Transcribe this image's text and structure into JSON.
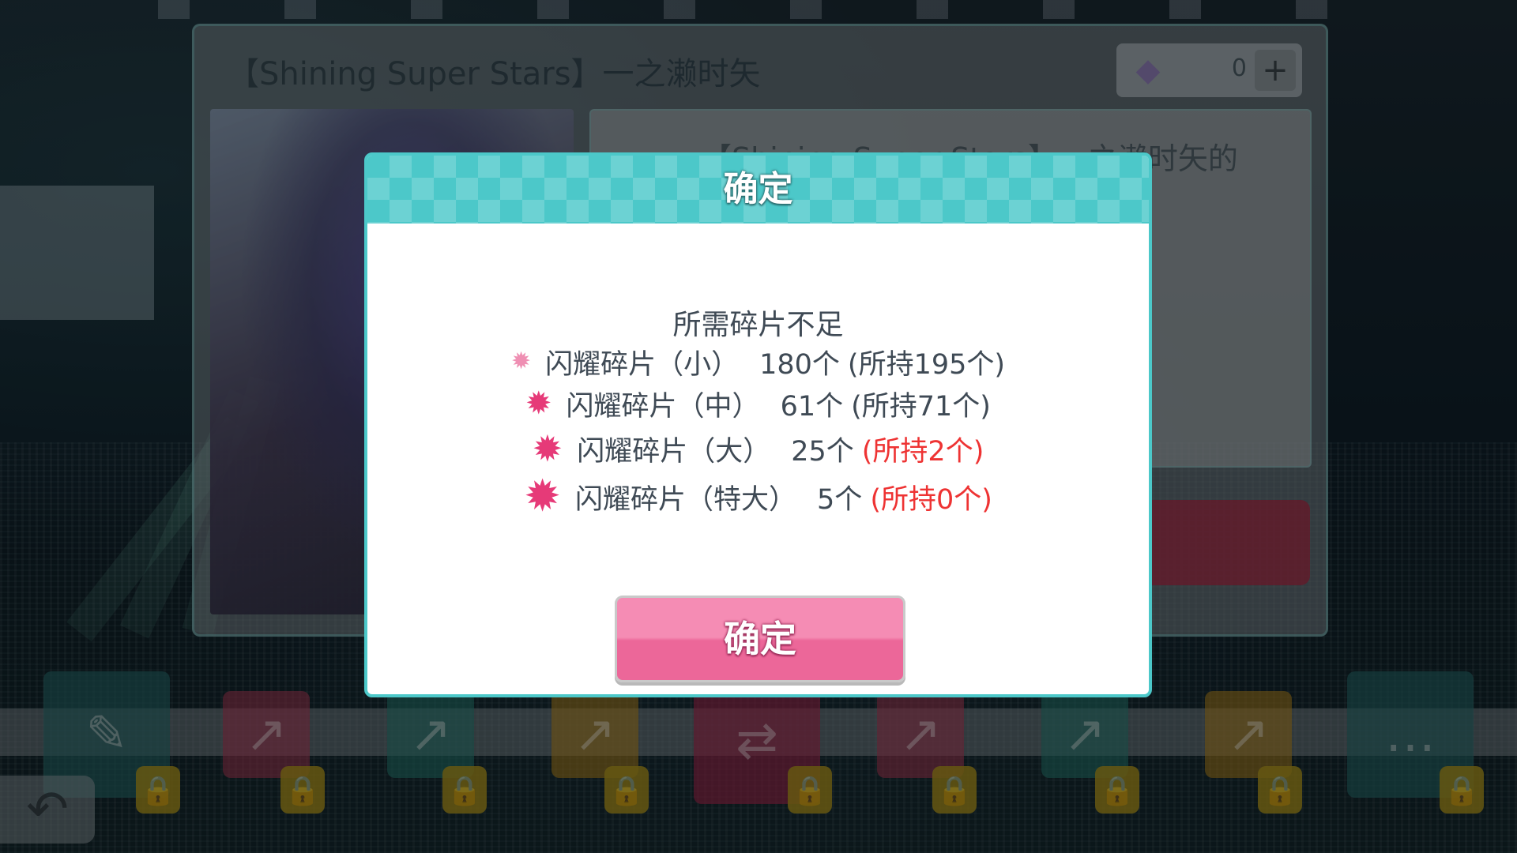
{
  "background": {
    "card_title": "【Shining Super Stars】一之濑时矢",
    "orb_count": "0",
    "plus_label": "+",
    "card_desc_text": "【Shining Super Stars】一之濑时矢的"
  },
  "dialog": {
    "title": "确定",
    "message": "所需碎片不足",
    "items": [
      {
        "icon": "shine-fragment-small-icon",
        "name": "闪耀碎片（小）",
        "need": "180个",
        "held": "(所持195个)",
        "short": false
      },
      {
        "icon": "shine-fragment-medium-icon",
        "name": "闪耀碎片（中）",
        "need": "61个",
        "held": "(所持71个)",
        "short": false
      },
      {
        "icon": "shine-fragment-large-icon",
        "name": "闪耀碎片（大）",
        "need": "25个",
        "held": "(所持2个)",
        "short": true
      },
      {
        "icon": "shine-fragment-xl-icon",
        "name": "闪耀碎片（特大）",
        "need": "5个",
        "held": "(所持0个)",
        "short": true
      }
    ],
    "confirm_label": "确定"
  },
  "colors": {
    "accent_teal": "#4cc8c9",
    "button_pink": "#ec6799",
    "shortage_red": "#ee3333",
    "fragment_pink": "#e63a78"
  }
}
